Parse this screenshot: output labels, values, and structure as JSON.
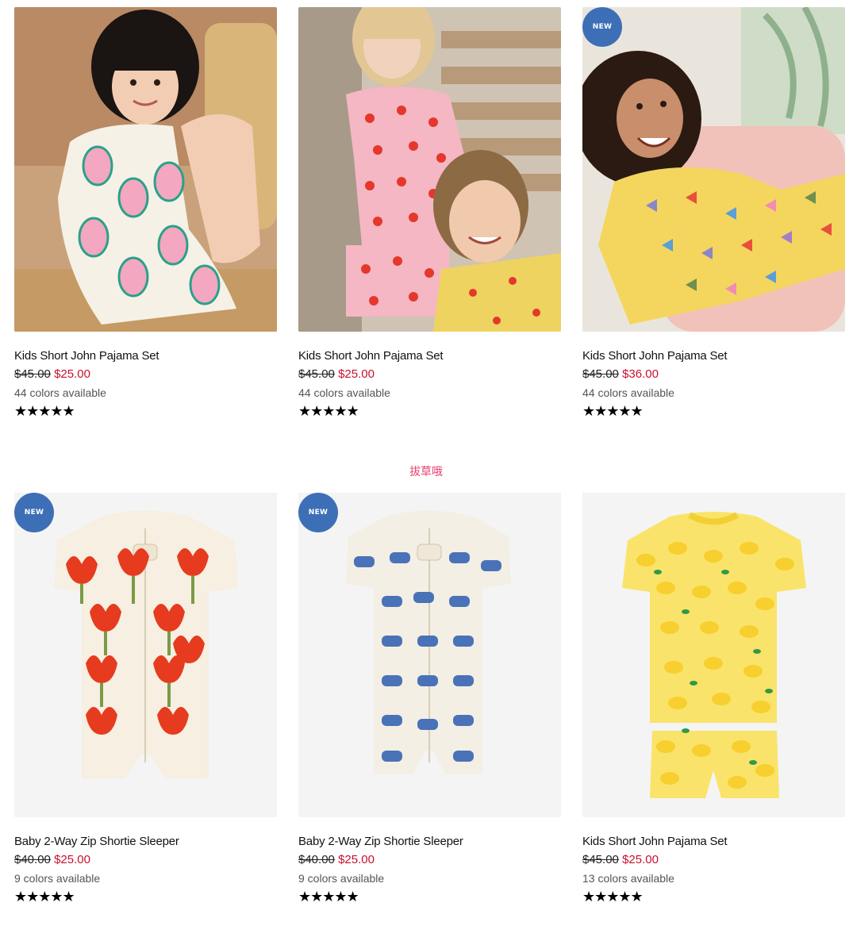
{
  "products": [
    {
      "title": "Kids Short John Pajama Set",
      "price_old": "$45.00",
      "price_new": "$25.00",
      "colors_text": "44 colors available",
      "rating_stars": "★★★★★",
      "rating": 5,
      "badge": ""
    },
    {
      "title": "Kids Short John Pajama Set",
      "price_old": "$45.00",
      "price_new": "$25.00",
      "colors_text": "44 colors available",
      "rating_stars": "★★★★★",
      "rating": 5,
      "badge": ""
    },
    {
      "title": "Kids Short John Pajama Set",
      "price_old": "$45.00",
      "price_new": "$36.00",
      "colors_text": "44 colors available",
      "rating_stars": "★★★★★",
      "rating": 5,
      "badge": "NEW"
    },
    {
      "title": "Baby 2-Way Zip Shortie Sleeper",
      "price_old": "$40.00",
      "price_new": "$25.00",
      "colors_text": "9 colors available",
      "rating_stars": "★★★★★",
      "rating": 5,
      "badge": "NEW"
    },
    {
      "title": "Baby 2-Way Zip Shortie Sleeper",
      "price_old": "$40.00",
      "price_new": "$25.00",
      "colors_text": "9 colors available",
      "rating_stars": "★★★★★",
      "rating": 5,
      "badge": "NEW"
    },
    {
      "title": "Kids Short John Pajama Set",
      "price_old": "$45.00",
      "price_new": "$25.00",
      "colors_text": "13 colors available",
      "rating_stars": "★★★★★",
      "rating": 5,
      "badge": ""
    }
  ],
  "watermark": "拔草哦",
  "colors": {
    "badge_bg": "#3d6fb6",
    "sale_price": "#c8102e",
    "watermark": "#e8426f"
  }
}
